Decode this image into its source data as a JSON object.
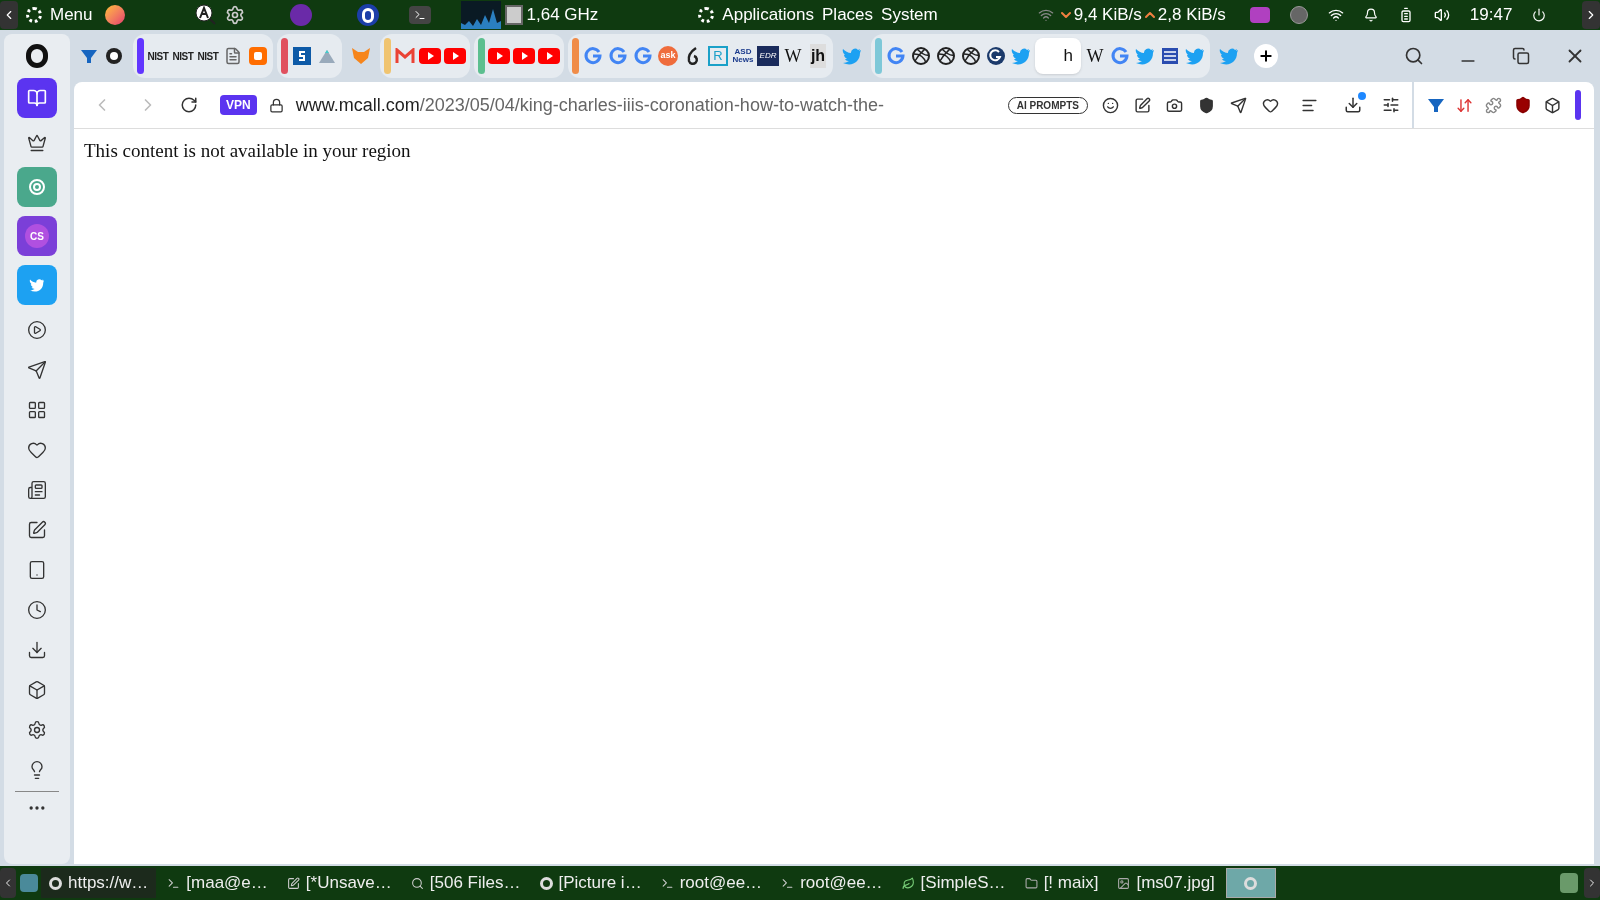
{
  "top_panel": {
    "menu": "Menu",
    "cpu": "1,64 GHz",
    "menus": [
      "Applications",
      "Places",
      "System"
    ],
    "download_rate": "9,4 KiB/s",
    "upload_rate": "2,8 KiB/s",
    "clock": "19:47"
  },
  "tab_groups": [
    {
      "tabs": [
        {
          "kind": "vee",
          "selected": false
        },
        {
          "kind": "github",
          "selected": false
        }
      ]
    },
    {
      "color": "#6236ff",
      "tabs": [
        {
          "kind": "nist",
          "glyph": "NIST",
          "selected": false
        },
        {
          "kind": "nist",
          "glyph": "NIST",
          "selected": false
        },
        {
          "kind": "nist",
          "glyph": "NIST",
          "selected": false
        },
        {
          "kind": "doc",
          "selected": false
        },
        {
          "kind": "blogger",
          "selected": false
        }
      ]
    },
    {
      "color": "#e0505e",
      "tabs": [
        {
          "kind": "sbox",
          "selected": false
        },
        {
          "kind": "mountain",
          "selected": false
        }
      ]
    },
    {
      "tabs": [
        {
          "kind": "fox",
          "selected": false
        }
      ]
    },
    {
      "color": "#f0c470",
      "tabs": [
        {
          "kind": "mail",
          "selected": false
        },
        {
          "kind": "play",
          "selected": false
        },
        {
          "kind": "play",
          "selected": false
        }
      ]
    },
    {
      "color": "#5cbf8f",
      "tabs": [
        {
          "kind": "play",
          "selected": false
        },
        {
          "kind": "play",
          "selected": false
        },
        {
          "kind": "play",
          "selected": false
        }
      ]
    },
    {
      "color": "#f08c48",
      "tabs": [
        {
          "kind": "g",
          "selected": false
        },
        {
          "kind": "g",
          "selected": false
        },
        {
          "kind": "g",
          "selected": false
        },
        {
          "kind": "ask",
          "glyph": "ask",
          "selected": false
        },
        {
          "kind": "six",
          "selected": false
        },
        {
          "kind": "r",
          "glyph": "R",
          "selected": false
        },
        {
          "kind": "asd",
          "glyph": "ASD News",
          "selected": false
        },
        {
          "kind": "edr",
          "glyph": "EDR",
          "selected": false
        },
        {
          "kind": "w",
          "glyph": "W",
          "selected": false
        },
        {
          "kind": "jh",
          "glyph": "jh",
          "selected": false
        }
      ]
    },
    {
      "tabs": [
        {
          "kind": "bird",
          "selected": false
        }
      ]
    },
    {
      "color": "#7ec8d8",
      "tabs": [
        {
          "kind": "g",
          "selected": false
        },
        {
          "kind": "ball",
          "selected": false
        },
        {
          "kind": "ball",
          "selected": false
        },
        {
          "kind": "ball",
          "selected": false
        },
        {
          "kind": "gcircle",
          "selected": false
        },
        {
          "kind": "bird",
          "selected": false
        },
        {
          "kind": "text",
          "glyph": "h",
          "selected": true
        },
        {
          "kind": "w",
          "glyph": "W",
          "selected": false
        },
        {
          "kind": "g",
          "selected": false
        },
        {
          "kind": "bird",
          "selected": false
        },
        {
          "kind": "crest",
          "selected": false
        },
        {
          "kind": "bird",
          "selected": false
        }
      ]
    },
    {
      "tabs": [
        {
          "kind": "bird",
          "selected": false
        }
      ]
    }
  ],
  "address_bar": {
    "vpn": "VPN",
    "host": "www.mcall.com",
    "path": "/2023/05/04/king-charles-iiis-coronation-how-to-watch-the-",
    "ai_prompts": "AI PROMPTS",
    "download_badge": true
  },
  "sidebar": [
    {
      "kind": "book",
      "selected": true
    },
    {
      "kind": "crown",
      "selected": false
    },
    {
      "kind": "chat",
      "selected": false
    },
    {
      "kind": "cs",
      "glyph": "CS",
      "selected": false
    },
    {
      "kind": "bird",
      "selected": false
    },
    {
      "kind": "player",
      "selected": false
    },
    {
      "kind": "send",
      "selected": false
    },
    {
      "kind": "apps",
      "selected": false
    },
    {
      "kind": "heart",
      "selected": false
    },
    {
      "kind": "news",
      "selected": false
    },
    {
      "kind": "pen",
      "selected": false
    },
    {
      "kind": "tabs",
      "selected": false
    },
    {
      "kind": "history",
      "selected": false
    },
    {
      "kind": "download",
      "selected": false
    },
    {
      "kind": "box",
      "selected": false
    },
    {
      "kind": "settings",
      "selected": false
    },
    {
      "kind": "bulb",
      "selected": false
    }
  ],
  "page": {
    "message": "This content is not available in your region"
  },
  "taskbar": [
    {
      "kind": "opera",
      "label": "https://w…",
      "selected": false
    },
    {
      "kind": "term",
      "label": "[maa@e…",
      "selected": false
    },
    {
      "kind": "edit",
      "label": "[*Unsave…",
      "selected": false
    },
    {
      "kind": "files",
      "label": "[506 Files…",
      "selected": false
    },
    {
      "kind": "opera",
      "label": "[Picture i…",
      "selected": false
    },
    {
      "kind": "term",
      "label": "root@ee…",
      "selected": false
    },
    {
      "kind": "term",
      "label": "root@ee…",
      "selected": false
    },
    {
      "kind": "leaf",
      "label": "[SimpleS…",
      "selected": false
    },
    {
      "kind": "folder",
      "label": "[! maix]",
      "selected": false
    },
    {
      "kind": "img",
      "label": "[ms07.jpg]",
      "selected": false
    },
    {
      "kind": "opera",
      "selected": true
    }
  ]
}
